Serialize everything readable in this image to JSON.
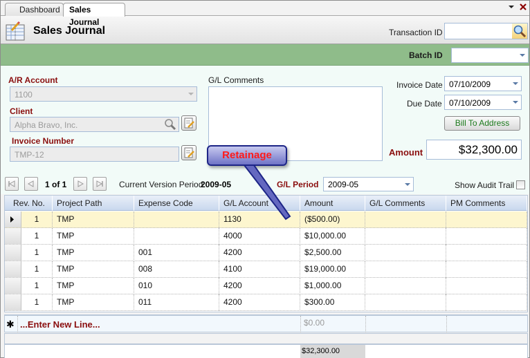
{
  "tabs": [
    {
      "label": "Dashboard",
      "active": false
    },
    {
      "label": "Sales Journal",
      "active": true
    }
  ],
  "tab_controls": {
    "menu_icon": "dropdown-arrow-icon",
    "close_icon": "close-icon"
  },
  "header": {
    "title": "Sales Journal",
    "icon": "journal-pencil-icon",
    "transaction_id_label": "Transaction ID",
    "transaction_id_value": "",
    "search_icon": "search-icon"
  },
  "band": {
    "batch_id_label": "Batch ID",
    "batch_id_value": ""
  },
  "form": {
    "ar_account_label": "A/R Account",
    "ar_account_value": "1100",
    "client_label": "Client",
    "client_value": "Alpha Bravo, Inc.",
    "invoice_number_label": "Invoice Number",
    "invoice_number_value": "TMP-12",
    "gl_comments_label": "G/L Comments",
    "gl_comments_value": "",
    "invoice_date_label": "Invoice Date",
    "invoice_date_value": "07/10/2009",
    "due_date_label": "Due Date",
    "due_date_value": "07/10/2009",
    "bill_to_button": "Bill To Address",
    "amount_label": "Amount",
    "amount_value": "$32,300.00"
  },
  "callout": {
    "text": "Retainage"
  },
  "nav": {
    "record_position": "1 of 1",
    "current_version_label": "Current Version Period",
    "current_version_value": "2009-05",
    "gl_period_label": "G/L Period",
    "gl_period_value": "2009-05",
    "show_audit_trail_label": "Show Audit Trail",
    "show_audit_trail_checked": false
  },
  "grid": {
    "columns": [
      "Rev. No.",
      "Project Path",
      "Expense Code",
      "G/L Account",
      "Amount",
      "G/L Comments",
      "PM Comments"
    ],
    "rows": [
      {
        "rev": "1",
        "project": "TMP",
        "expense": "",
        "account": "1130",
        "amount": "($500.00)",
        "gl_comments": "",
        "pm_comments": "",
        "selected": true
      },
      {
        "rev": "1",
        "project": "TMP",
        "expense": "",
        "account": "4000",
        "amount": "$10,000.00",
        "gl_comments": "",
        "pm_comments": ""
      },
      {
        "rev": "1",
        "project": "TMP",
        "expense": "001",
        "account": "4200",
        "amount": "$2,500.00",
        "gl_comments": "",
        "pm_comments": ""
      },
      {
        "rev": "1",
        "project": "TMP",
        "expense": "008",
        "account": "4100",
        "amount": "$19,000.00",
        "gl_comments": "",
        "pm_comments": ""
      },
      {
        "rev": "1",
        "project": "TMP",
        "expense": "010",
        "account": "4200",
        "amount": "$1,000.00",
        "gl_comments": "",
        "pm_comments": ""
      },
      {
        "rev": "1",
        "project": "TMP",
        "expense": "011",
        "account": "4200",
        "amount": "$300.00",
        "gl_comments": "",
        "pm_comments": ""
      }
    ],
    "new_line_label": "...Enter New Line...",
    "new_line_amount": "$0.00",
    "total_amount": "$32,300.00"
  },
  "colors": {
    "accent_green": "#8fbc8a",
    "label_red": "#8a0e0e",
    "selected_row": "#fdf6cf",
    "callout_text": "#ff1a1a"
  }
}
